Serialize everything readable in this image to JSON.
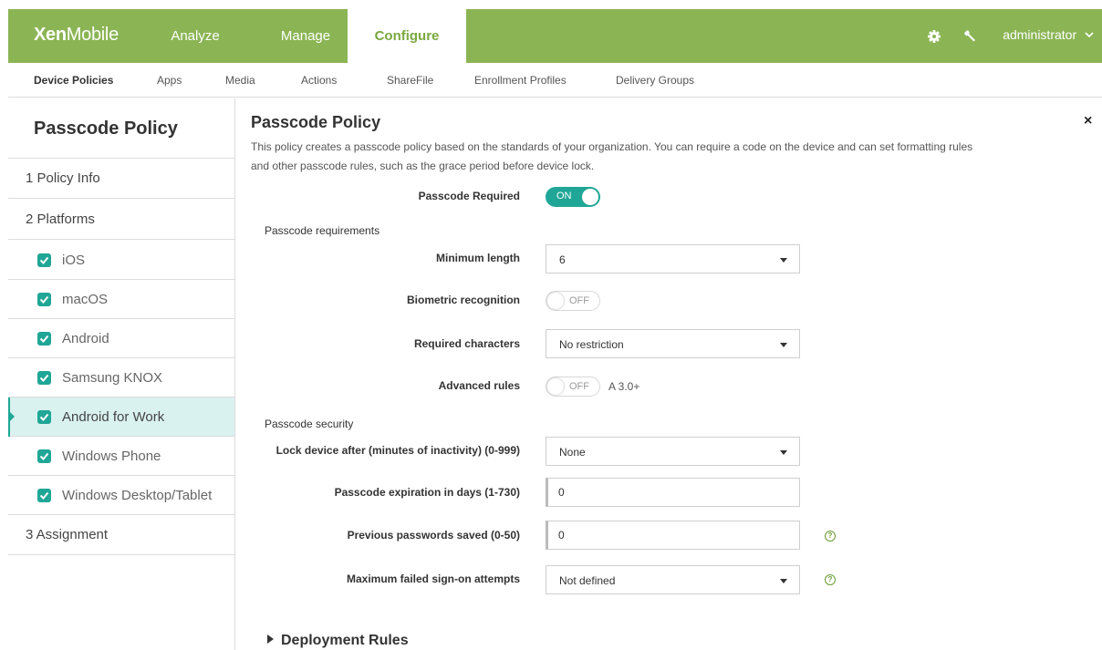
{
  "header": {
    "logo_bold": "Xen",
    "logo_light": "Mobile",
    "nav": [
      {
        "label": "Analyze"
      },
      {
        "label": "Manage"
      },
      {
        "label": "Configure",
        "active": true
      }
    ],
    "settings_icon": "gear-icon",
    "tools_icon": "wrench-icon",
    "user": "administrator"
  },
  "subnav": [
    {
      "label": "Device Policies",
      "active": true
    },
    {
      "label": "Apps"
    },
    {
      "label": "Media"
    },
    {
      "label": "Actions"
    },
    {
      "label": "ShareFile"
    },
    {
      "label": "Enrollment Profiles"
    },
    {
      "label": "Delivery Groups"
    }
  ],
  "sidebar": {
    "title": "Passcode Policy",
    "steps": {
      "policy_info": "1  Policy Info",
      "platforms": "2  Platforms",
      "assignment": "3  Assignment"
    },
    "platforms": [
      {
        "label": "iOS",
        "checked": true
      },
      {
        "label": "macOS",
        "checked": true
      },
      {
        "label": "Android",
        "checked": true
      },
      {
        "label": "Samsung KNOX",
        "checked": true
      },
      {
        "label": "Android for Work",
        "checked": true,
        "active": true
      },
      {
        "label": "Windows Phone",
        "checked": true
      },
      {
        "label": "Windows Desktop/Tablet",
        "checked": true
      }
    ]
  },
  "main": {
    "title": "Passcode Policy",
    "close": "×",
    "description": "This policy creates a passcode policy based on the standards of your organization. You can require a code on the device and can set formatting rules and other passcode rules, such as the grace period before device lock.",
    "passcode_required": {
      "label": "Passcode Required",
      "state": "ON"
    },
    "requirements_section": "Passcode requirements",
    "minimum_length": {
      "label": "Minimum length",
      "value": "6"
    },
    "biometric": {
      "label": "Biometric recognition",
      "state": "OFF"
    },
    "required_characters": {
      "label": "Required characters",
      "value": "No restriction"
    },
    "advanced_rules": {
      "label": "Advanced rules",
      "state": "OFF",
      "note": "A 3.0+"
    },
    "security_section": "Passcode security",
    "lock_device": {
      "label": "Lock device after (minutes of inactivity) (0-999)",
      "value": "None"
    },
    "expiration": {
      "label": "Passcode expiration in days (1-730)",
      "value": "0"
    },
    "previous_passwords": {
      "label": "Previous passwords saved (0-50)",
      "value": "0"
    },
    "max_failed": {
      "label": "Maximum failed sign-on attempts",
      "value": "Not defined"
    },
    "help_glyph": "?",
    "deployment_rules": "Deployment Rules"
  },
  "colors": {
    "header_green": "#8bb554",
    "accent_teal": "#1fa696",
    "active_row": "#d9f2ef"
  }
}
